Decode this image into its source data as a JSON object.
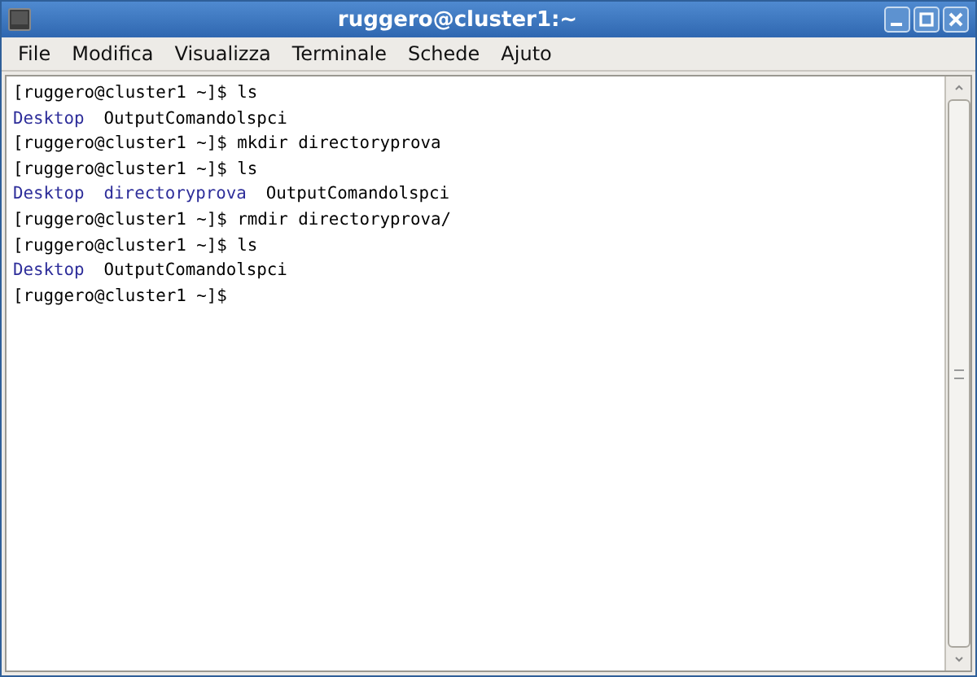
{
  "window": {
    "title": "ruggero@cluster1:~"
  },
  "menu": [
    "File",
    "Modifica",
    "Visualizza",
    "Terminale",
    "Schede",
    "Ajuto"
  ],
  "terminal": {
    "lines": [
      {
        "kind": "prompt",
        "text": "[ruggero@cluster1 ~]$ ls"
      },
      {
        "kind": "listing",
        "entries": [
          {
            "name": "Desktop",
            "color": "#2e2e9a"
          },
          {
            "name": "OutputComandolspci",
            "color": "#000000"
          }
        ]
      },
      {
        "kind": "prompt",
        "text": "[ruggero@cluster1 ~]$ mkdir directoryprova"
      },
      {
        "kind": "prompt",
        "text": "[ruggero@cluster1 ~]$ ls"
      },
      {
        "kind": "listing",
        "entries": [
          {
            "name": "Desktop",
            "color": "#2e2e9a"
          },
          {
            "name": "directoryprova",
            "color": "#2e2e9a"
          },
          {
            "name": "OutputComandolspci",
            "color": "#000000"
          }
        ]
      },
      {
        "kind": "prompt",
        "text": "[ruggero@cluster1 ~]$ rmdir directoryprova/"
      },
      {
        "kind": "prompt",
        "text": "[ruggero@cluster1 ~]$ ls"
      },
      {
        "kind": "listing",
        "entries": [
          {
            "name": "Desktop",
            "color": "#2e2e9a"
          },
          {
            "name": "OutputComandolspci",
            "color": "#000000"
          }
        ]
      },
      {
        "kind": "prompt",
        "text": "[ruggero@cluster1 ~]$"
      }
    ]
  }
}
